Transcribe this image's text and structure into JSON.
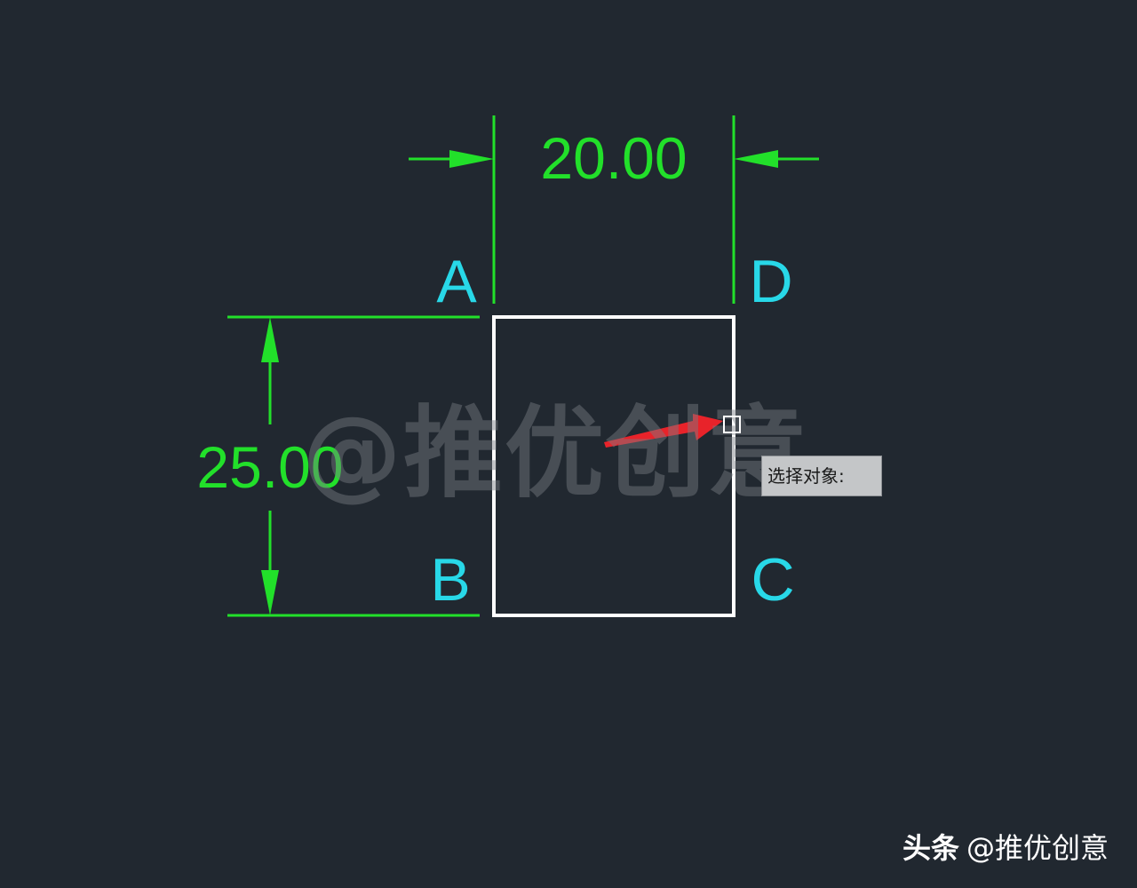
{
  "drawing": {
    "horizontal_dimension": "20.00",
    "vertical_dimension": "25.00",
    "vertices": {
      "a": "A",
      "b": "B",
      "c": "C",
      "d": "D"
    }
  },
  "cursor_tooltip": {
    "prompt": "选择对象:"
  },
  "watermark": {
    "text": "@推优创意"
  },
  "footer": {
    "brand": "头条",
    "handle": "@推优创意"
  },
  "colors": {
    "background": "#212830",
    "dimension": "#22e02a",
    "vertex_label": "#28d8e8",
    "rectangle": "#ffffff",
    "annotation_arrow": "#e8232a",
    "tooltip_bg": "#c4c6c8"
  },
  "icons": {
    "cursor": "pickbox-icon",
    "annotation": "red-arrow-icon"
  }
}
